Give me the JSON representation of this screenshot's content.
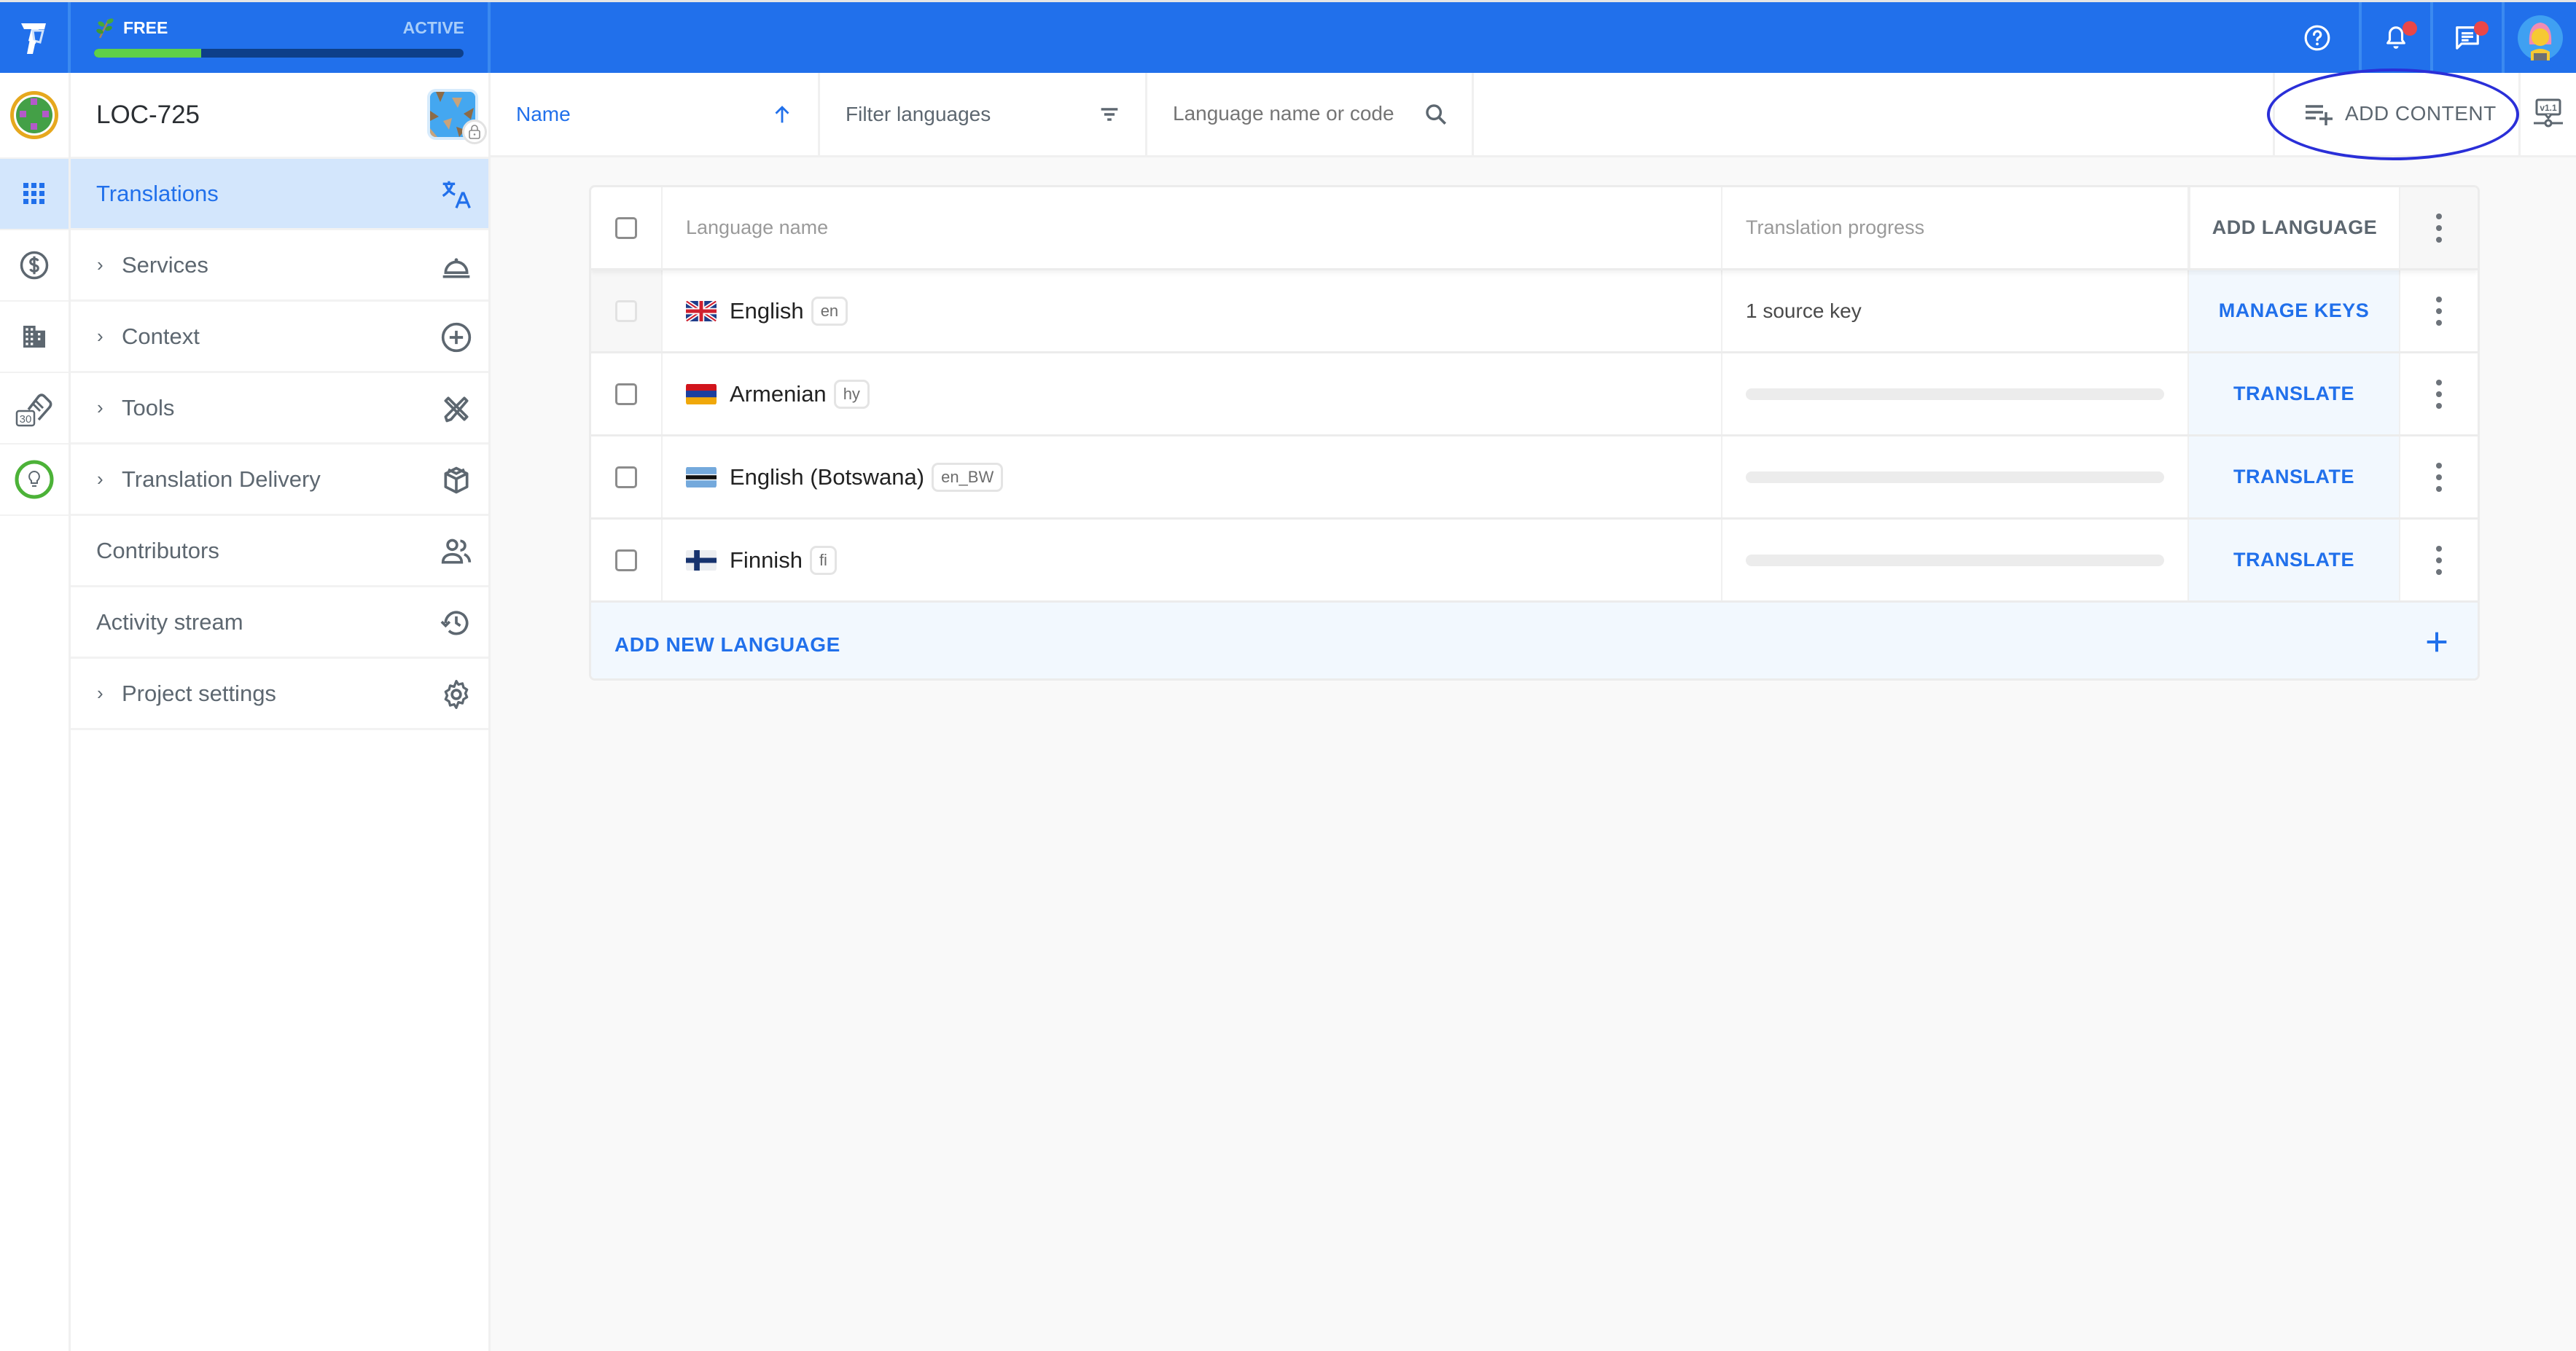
{
  "topbar": {
    "plan": {
      "name": "FREE",
      "status": "ACTIVE",
      "usage_fraction": 0.29
    },
    "icons": [
      "help-icon",
      "notifications-icon",
      "messages-icon",
      "user-avatar"
    ],
    "notifications_badge": true,
    "messages_badge": true
  },
  "project": {
    "title": "LOC-725"
  },
  "rail": {
    "badge_number": "30"
  },
  "sidebar": {
    "items": [
      {
        "label": "Translations",
        "icon": "translate-icon",
        "expandable": false,
        "active": true
      },
      {
        "label": "Services",
        "icon": "service-bell-icon",
        "expandable": true
      },
      {
        "label": "Context",
        "icon": "add-circle-icon",
        "expandable": true
      },
      {
        "label": "Tools",
        "icon": "tools-icon",
        "expandable": true
      },
      {
        "label": "Translation Delivery",
        "icon": "package-icon",
        "expandable": true
      },
      {
        "label": "Contributors",
        "icon": "people-icon",
        "expandable": false
      },
      {
        "label": "Activity stream",
        "icon": "history-icon",
        "expandable": false
      },
      {
        "label": "Project settings",
        "icon": "gear-icon",
        "expandable": true
      }
    ]
  },
  "toolbar": {
    "sort_label": "Name",
    "sort_direction": "ascending",
    "filter_label": "Filter languages",
    "search_placeholder": "Language name or code",
    "add_content_label": "ADD CONTENT",
    "version_label": "v1.1"
  },
  "table": {
    "headers": {
      "name": "Language name",
      "progress": "Translation progress",
      "action": "ADD LANGUAGE"
    },
    "rows": [
      {
        "name": "English",
        "code": "en",
        "flag": "gb",
        "progress_text": "1 source key",
        "progress": null,
        "action": "MANAGE KEYS",
        "checkbox_disabled": true
      },
      {
        "name": "Armenian",
        "code": "hy",
        "flag": "am",
        "progress_text": "",
        "progress": 0,
        "action": "TRANSLATE",
        "checkbox_disabled": false
      },
      {
        "name": "English (Botswana)",
        "code": "en_BW",
        "flag": "bw",
        "progress_text": "",
        "progress": 0,
        "action": "TRANSLATE",
        "checkbox_disabled": false
      },
      {
        "name": "Finnish",
        "code": "fi",
        "flag": "fi",
        "progress_text": "",
        "progress": 0,
        "action": "TRANSLATE",
        "checkbox_disabled": false
      }
    ],
    "add_new_label": "ADD NEW LANGUAGE"
  },
  "colors": {
    "brand_blue": "#2170eb",
    "progress_green": "#5fd047",
    "highlight_ring": "#2a2fd8",
    "badge_red": "#ea4747"
  }
}
